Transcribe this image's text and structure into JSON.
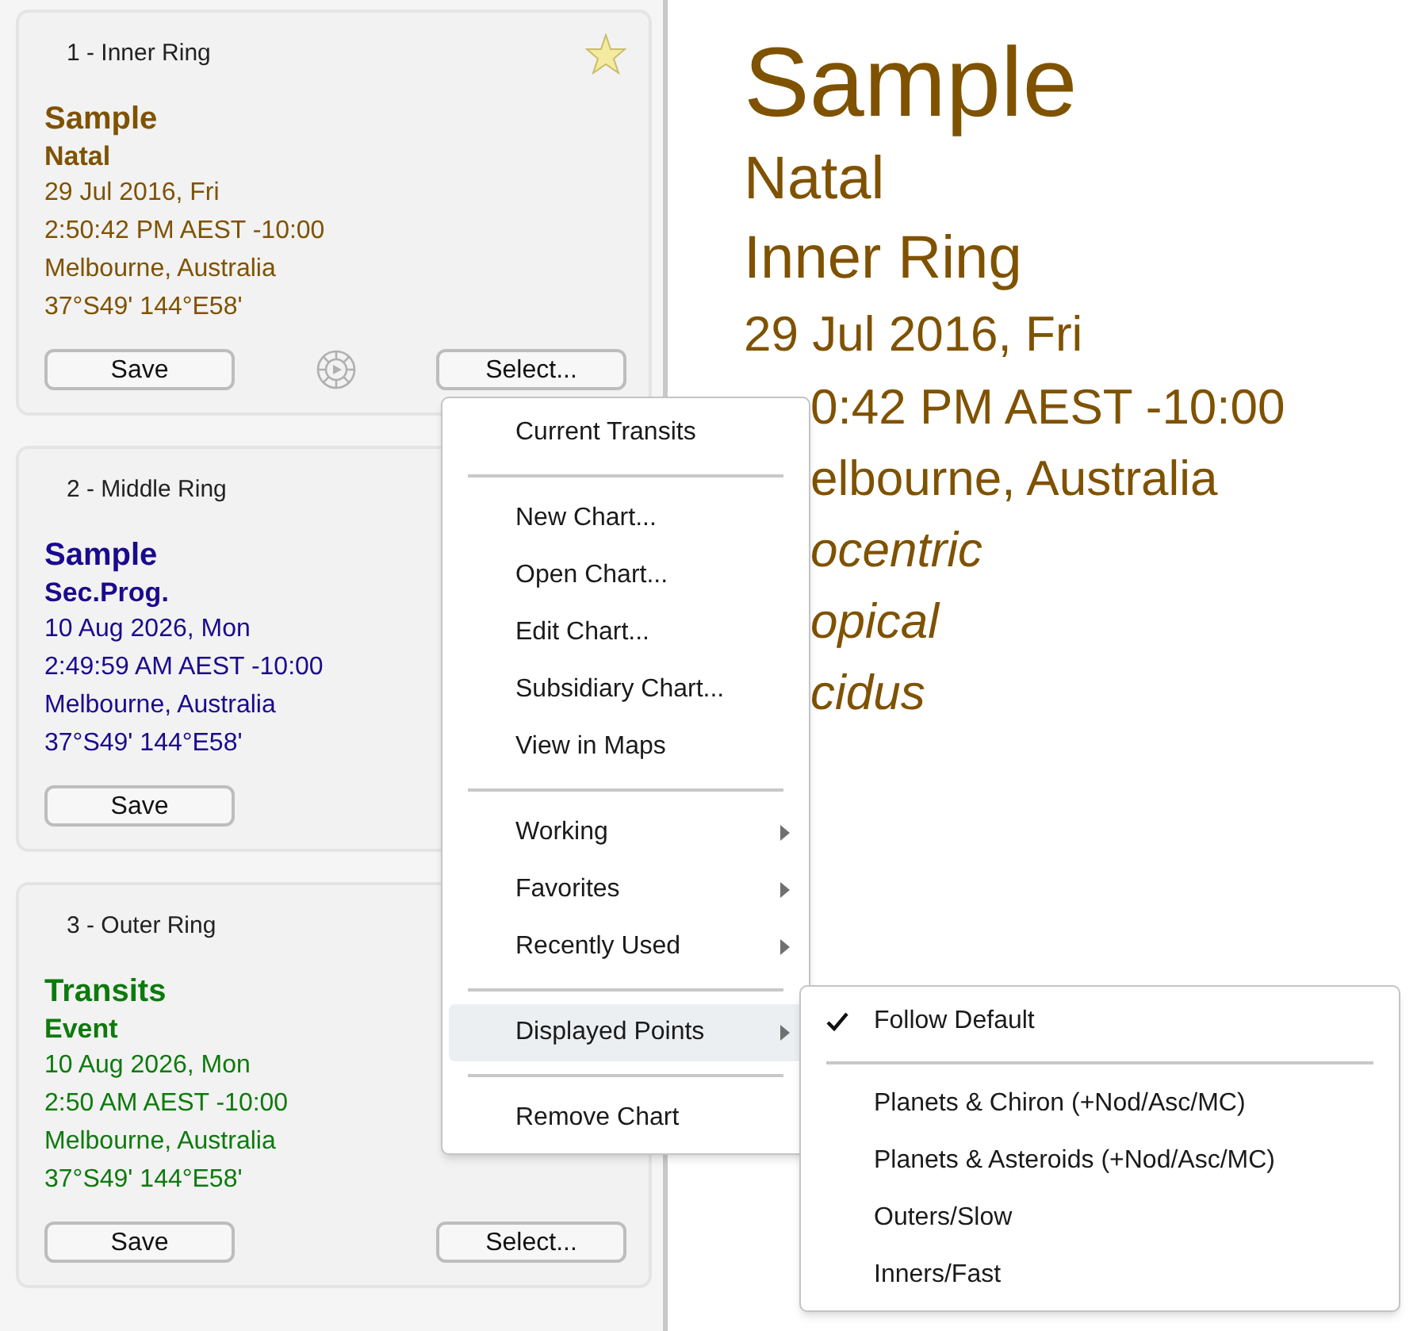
{
  "cards": [
    {
      "header": "1 - Inner Ring",
      "favorite": true,
      "current": true,
      "color": "#7f5200",
      "name": "Sample",
      "type": "Natal",
      "lines": [
        "29 Jul 2016, Fri",
        "2:50:42 PM AEST -10:00",
        "Melbourne, Australia",
        "37°S49' 144°E58'"
      ],
      "buttons": [
        "Save",
        "Select..."
      ]
    },
    {
      "header": "2 - Middle Ring",
      "favorite": false,
      "current": false,
      "color": "#1a0a8c",
      "name": "Sample",
      "type": "Sec.Prog.",
      "lines": [
        "10 Aug 2026, Mon",
        "2:49:59 AM AEST -10:00",
        "Melbourne, Australia",
        "37°S49' 144°E58'"
      ],
      "buttons": [
        "Save"
      ]
    },
    {
      "header": "3 - Outer Ring",
      "favorite": false,
      "current": false,
      "color": "#0d7a0d",
      "name": "Transits",
      "type": "Event",
      "lines": [
        "10 Aug 2026, Mon",
        "2:50 AM AEST -10:00",
        "Melbourne, Australia",
        "37°S49' 144°E58'"
      ],
      "buttons": [
        "Save",
        "Select..."
      ]
    }
  ],
  "details": [
    {
      "kind": "title",
      "text": "Sample",
      "italic": false
    },
    {
      "kind": "heading",
      "text": "Natal",
      "italic": false
    },
    {
      "kind": "heading",
      "text": "Inner Ring",
      "italic": false
    },
    {
      "kind": "line",
      "text": "29 Jul 2016, Fri",
      "italic": false
    },
    {
      "kind": "covered",
      "text": "0:42 PM AEST -10:00",
      "italic": false
    },
    {
      "kind": "covered",
      "text": "elbourne, Australia",
      "italic": false
    },
    {
      "kind": "covered",
      "text": "ocentric",
      "italic": true
    },
    {
      "kind": "covered",
      "text": "opical",
      "italic": true
    },
    {
      "kind": "covered",
      "text": "cidus",
      "italic": true
    }
  ],
  "menu": [
    {
      "kind": "item",
      "label": "Current Transits",
      "submenu": false,
      "selected": false
    },
    {
      "kind": "separator"
    },
    {
      "kind": "item",
      "label": "New Chart...",
      "submenu": false,
      "selected": false
    },
    {
      "kind": "item",
      "label": "Open Chart...",
      "submenu": false,
      "selected": false
    },
    {
      "kind": "item",
      "label": "Edit Chart...",
      "submenu": false,
      "selected": false
    },
    {
      "kind": "item",
      "label": "Subsidiary Chart...",
      "submenu": false,
      "selected": false
    },
    {
      "kind": "item",
      "label": "View in Maps",
      "submenu": false,
      "selected": false
    },
    {
      "kind": "separator"
    },
    {
      "kind": "item",
      "label": "Working",
      "submenu": true,
      "selected": false
    },
    {
      "kind": "item",
      "label": "Favorites",
      "submenu": true,
      "selected": false
    },
    {
      "kind": "item",
      "label": "Recently Used",
      "submenu": true,
      "selected": false
    },
    {
      "kind": "separator"
    },
    {
      "kind": "item",
      "label": "Displayed Points",
      "submenu": true,
      "selected": true
    },
    {
      "kind": "separator"
    },
    {
      "kind": "item",
      "label": "Remove Chart",
      "submenu": false,
      "selected": false
    }
  ],
  "submenu": [
    {
      "kind": "item",
      "label": "Follow Default",
      "checked": true
    },
    {
      "kind": "separator"
    },
    {
      "kind": "item",
      "label": "Planets & Chiron (+Nod/Asc/MC)",
      "checked": false
    },
    {
      "kind": "item",
      "label": "Planets & Asteroids (+Nod/Asc/MC)",
      "checked": false
    },
    {
      "kind": "item",
      "label": "Outers/Slow",
      "checked": false
    },
    {
      "kind": "item",
      "label": "Inners/Fast",
      "checked": false
    }
  ]
}
